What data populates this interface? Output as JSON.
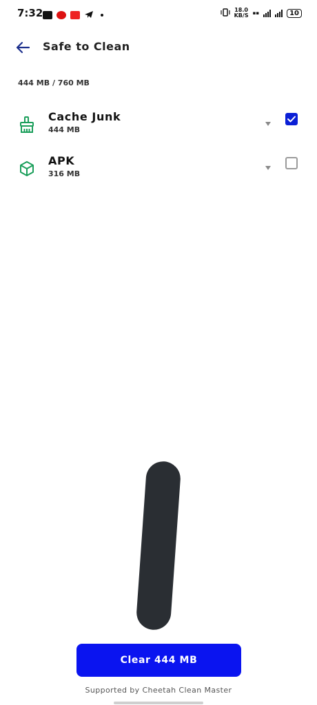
{
  "status_bar": {
    "time": "7:32",
    "net_speed_value": "18.0",
    "net_speed_unit": "KB/S",
    "battery": "10"
  },
  "header": {
    "back_icon": "arrow-left-icon",
    "title": "Safe to Clean"
  },
  "summary": "444 MB / 760 MB",
  "items": [
    {
      "label": "Cache Junk",
      "size": "444 MB",
      "icon": "broom-icon",
      "checked": true
    },
    {
      "label": "APK",
      "size": "316 MB",
      "icon": "package-icon",
      "checked": false
    }
  ],
  "actions": {
    "clear_label": "Clear 444 MB"
  },
  "footer": "Supported by Cheetah Clean Master",
  "colors": {
    "accent": "#0a14f0",
    "icon_green": "#1a9e5a",
    "back_arrow": "#1c2f8c"
  }
}
